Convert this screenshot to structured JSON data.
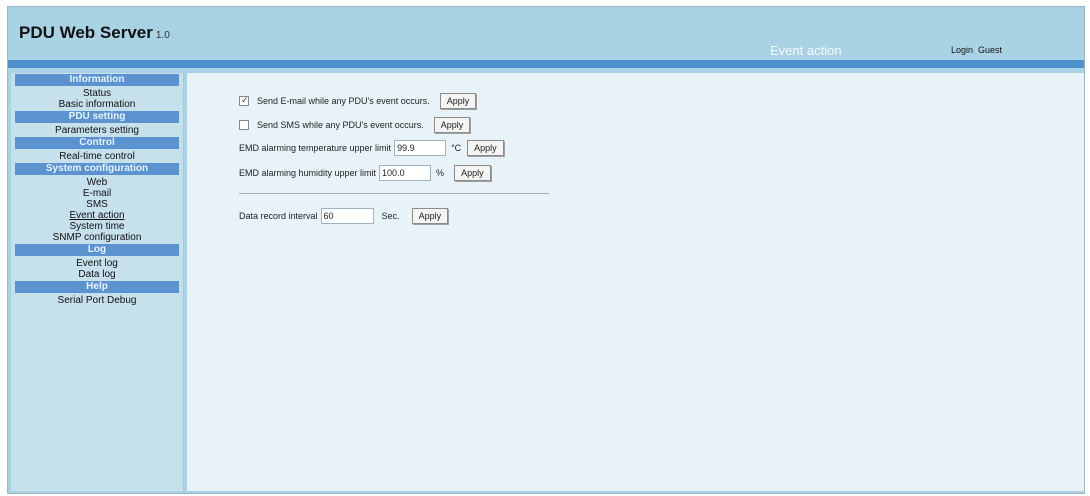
{
  "header": {
    "app_title": "PDU Web Server",
    "app_version": "1.0",
    "page_heading": "Event action",
    "login_label": "Login",
    "login_user": "Guest"
  },
  "sidebar": {
    "sections": [
      {
        "title": "Information",
        "items": [
          "Status",
          "Basic information"
        ]
      },
      {
        "title": "PDU setting",
        "items": [
          "Parameters setting"
        ]
      },
      {
        "title": "Control",
        "items": [
          "Real-time control"
        ]
      },
      {
        "title": "System configuration",
        "items": [
          "Web",
          "E-mail",
          "SMS",
          "Event action",
          "System time",
          "SNMP configuration"
        ]
      },
      {
        "title": "Log",
        "items": [
          "Event log",
          "Data log"
        ]
      },
      {
        "title": "Help",
        "items": [
          "Serial Port Debug"
        ]
      }
    ]
  },
  "content": {
    "email_event": {
      "label": "Send E-mail while any PDU's event occurs.",
      "checked": true,
      "button": "Apply"
    },
    "sms_event": {
      "label": "Send SMS while any PDU's event occurs.",
      "checked": false,
      "button": "Apply"
    },
    "temp_limit": {
      "label": "EMD alarming temperature upper limit",
      "value": "99.9",
      "unit": "°C",
      "button": "Apply"
    },
    "humidity_limit": {
      "label": "EMD alarming humidity upper limit",
      "value": "100.0",
      "unit": "%",
      "button": "Apply"
    },
    "data_interval": {
      "label": "Data record interval",
      "value": "60",
      "unit": "Sec.",
      "button": "Apply"
    }
  },
  "colors": {
    "frame_bg": "#a9d2e4",
    "strip_blue": "#4f8fcc",
    "section_header": "#5b93d1",
    "sidebar_bg": "#c6e0ec",
    "content_bg": "#e7f3f8"
  }
}
